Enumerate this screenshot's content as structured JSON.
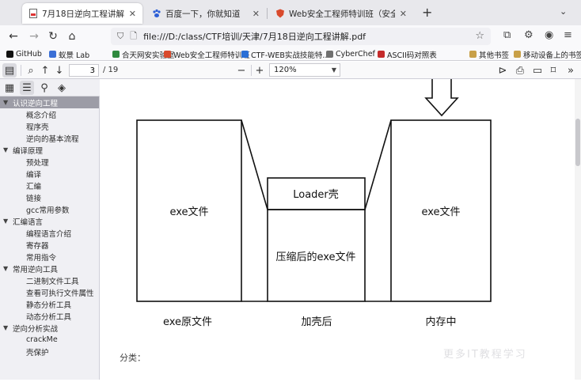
{
  "browser": {
    "tabs": [
      {
        "label": "7月18日逆向工程讲解.pdf",
        "close": "✕"
      },
      {
        "label": "百度一下，你就知道",
        "close": "✕"
      },
      {
        "label": "Web安全工程师特训班（安全",
        "close": "✕"
      }
    ],
    "url": "file:///D:/class/CTF培训/天津/7月18日逆向工程讲解.pdf"
  },
  "bookmarks": [
    {
      "label": "GitHub",
      "color": "#111111"
    },
    {
      "label": "蚁景 Lab",
      "color": "#3b6fd6"
    },
    {
      "label": "合天网安实验室",
      "color": "#2f8a3e"
    },
    {
      "label": "Web安全工程师特训班",
      "color": "#d94a2c"
    },
    {
      "label": "CTF-WEB实战技能特...",
      "color": "#2a6fd6"
    },
    {
      "label": "CyberChef",
      "color": "#6f6f6f"
    },
    {
      "label": "ASCII码对照表",
      "color": "#c42b2b"
    },
    {
      "label": "其他书签",
      "color": "#c8a048"
    },
    {
      "label": "移动设备上的书签",
      "color": "#c8a048"
    }
  ],
  "pdf_toolbar": {
    "page_current": "3",
    "page_total": "/ 19",
    "zoom": "120%"
  },
  "outline": [
    {
      "label": "认识逆向工程",
      "level": 1,
      "selected": true
    },
    {
      "label": "概念介绍",
      "level": 2
    },
    {
      "label": "程序壳",
      "level": 2
    },
    {
      "label": "逆向的基本流程",
      "level": 2
    },
    {
      "label": "编译原理",
      "level": 1
    },
    {
      "label": "预处理",
      "level": 2
    },
    {
      "label": "编译",
      "level": 2
    },
    {
      "label": "汇编",
      "level": 2
    },
    {
      "label": "链接",
      "level": 2
    },
    {
      "label": "gcc常用参数",
      "level": 2
    },
    {
      "label": "汇编语言",
      "level": 1
    },
    {
      "label": "编程语言介绍",
      "level": 2
    },
    {
      "label": "寄存器",
      "level": 2
    },
    {
      "label": "常用指令",
      "level": 2
    },
    {
      "label": "常用逆向工具",
      "level": 1
    },
    {
      "label": "二进制文件工具",
      "level": 2
    },
    {
      "label": "查看可执行文件属性",
      "level": 2
    },
    {
      "label": "静态分析工具",
      "level": 2
    },
    {
      "label": "动态分析工具",
      "level": 2
    },
    {
      "label": "逆向分析实战",
      "level": 1
    },
    {
      "label": "crackMe",
      "level": 2
    },
    {
      "label": "壳保护",
      "level": 2
    }
  ],
  "diagram": {
    "original_box": "exe文件",
    "loader_box": "Loader壳",
    "compressed_box": "压缩后的exe文件",
    "memory_box": "exe文件",
    "caption_original": "exe原文件",
    "caption_packed": "加壳后",
    "caption_memory": "内存中",
    "bottom_fragment": "分类："
  },
  "watermark": "更多IT教程学习"
}
